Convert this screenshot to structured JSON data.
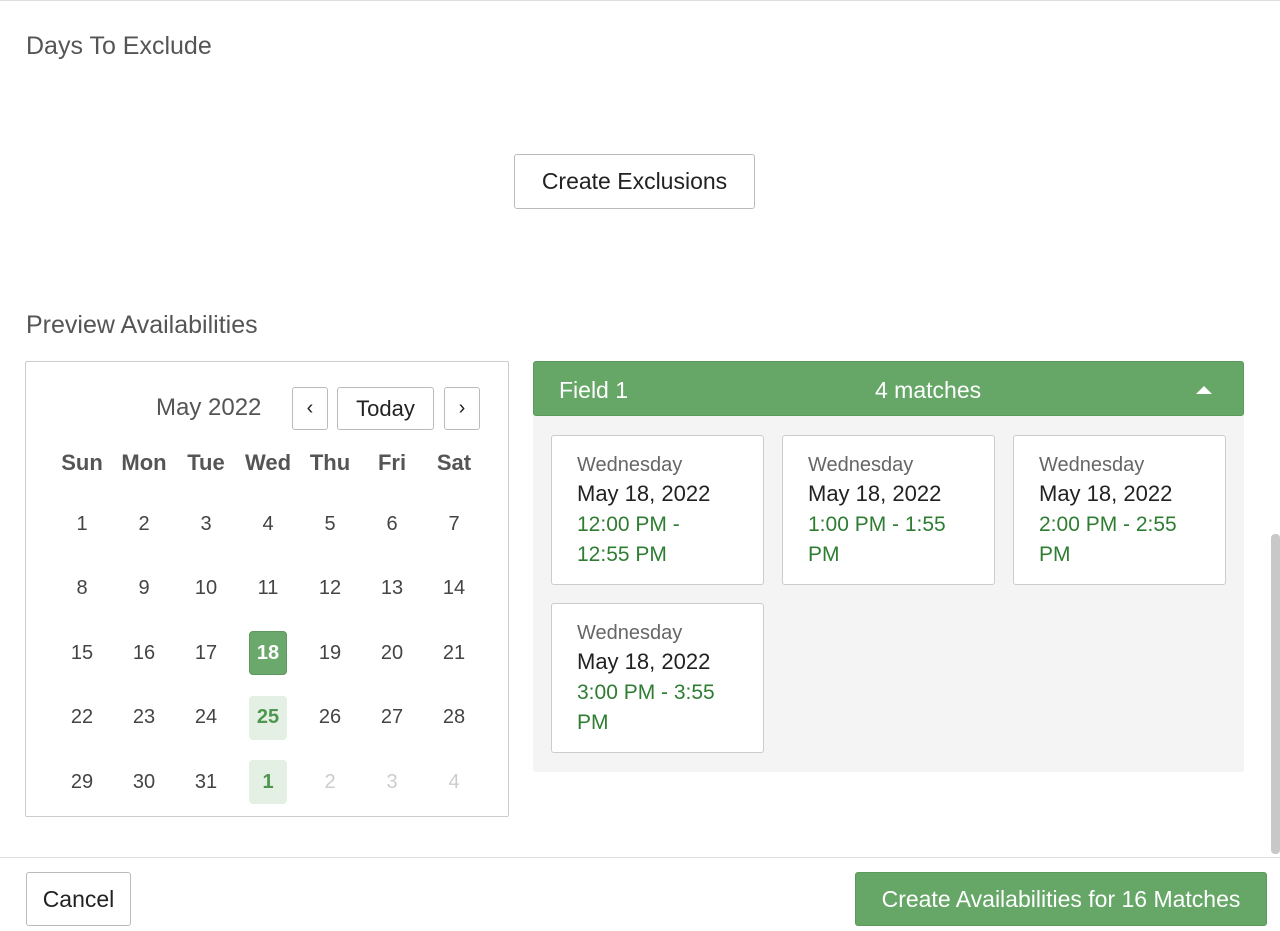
{
  "sections": {
    "exclude_title": "Days To Exclude",
    "preview_title": "Preview Availabilities"
  },
  "buttons": {
    "create_exclusions": "Create Exclusions",
    "prev": "‹",
    "today": "Today",
    "next": "›",
    "cancel": "Cancel",
    "create_availabilities": "Create Availabilities for 16 Matches"
  },
  "calendar": {
    "month_label": "May 2022",
    "weekdays": [
      "Sun",
      "Mon",
      "Tue",
      "Wed",
      "Thu",
      "Fri",
      "Sat"
    ],
    "weeks": [
      [
        "1",
        "2",
        "3",
        "4",
        "5",
        "6",
        "7"
      ],
      [
        "8",
        "9",
        "10",
        "11",
        "12",
        "13",
        "14"
      ],
      [
        "15",
        "16",
        "17",
        "18",
        "19",
        "20",
        "21"
      ],
      [
        "22",
        "23",
        "24",
        "25",
        "26",
        "27",
        "28"
      ],
      [
        "29",
        "30",
        "31",
        "1",
        "2",
        "3",
        "4"
      ]
    ],
    "selected_day": "18",
    "highlighted_days": [
      "25",
      "1 (June)"
    ]
  },
  "panel": {
    "field_name": "Field 1",
    "matches_label": "4 matches",
    "cards": [
      {
        "weekday": "Wednesday",
        "date": "May 18, 2022",
        "time": "12:00 PM - 12:55 PM"
      },
      {
        "weekday": "Wednesday",
        "date": "May 18, 2022",
        "time": "1:00 PM - 1:55 PM"
      },
      {
        "weekday": "Wednesday",
        "date": "May 18, 2022",
        "time": "2:00 PM - 2:55 PM"
      },
      {
        "weekday": "Wednesday",
        "date": "May 18, 2022",
        "time": "3:00 PM - 3:55 PM"
      }
    ]
  },
  "colors": {
    "accent_green": "#66a767",
    "time_green": "#2e7d32",
    "match_day_bg": "#e4f0e4"
  }
}
